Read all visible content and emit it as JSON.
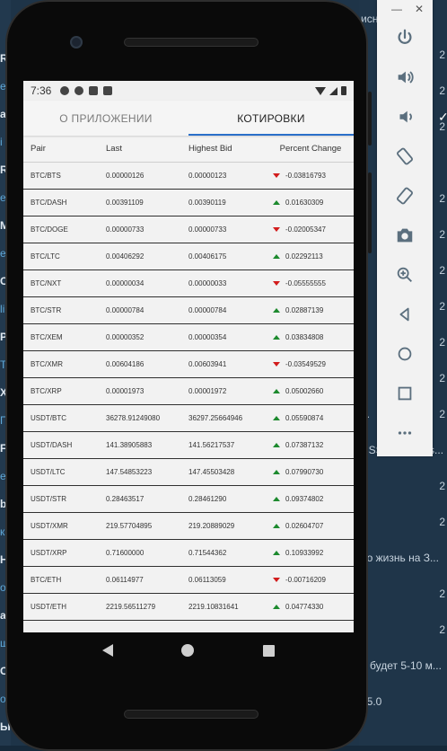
{
  "app": {
    "tabs": [
      {
        "label": "О ПРИЛОЖЕНИИ",
        "active": false
      },
      {
        "label": "КОТИРОВКИ",
        "active": true
      }
    ]
  },
  "statusbar": {
    "time": "7:36"
  },
  "table": {
    "headers": [
      "Pair",
      "Last",
      "Highest Bid",
      "Percent Change"
    ],
    "rows": [
      {
        "pair": "BTC/BTS",
        "last": "0.00000126",
        "bid": "0.00000123",
        "change": "-0.03816793",
        "dir": "down"
      },
      {
        "pair": "BTC/DASH",
        "last": "0.00391109",
        "bid": "0.00390119",
        "change": "0.01630309",
        "dir": "up"
      },
      {
        "pair": "BTC/DOGE",
        "last": "0.00000733",
        "bid": "0.00000733",
        "change": "-0.02005347",
        "dir": "down"
      },
      {
        "pair": "BTC/LTC",
        "last": "0.00406292",
        "bid": "0.00406175",
        "change": "0.02292113",
        "dir": "up"
      },
      {
        "pair": "BTC/NXT",
        "last": "0.00000034",
        "bid": "0.00000033",
        "change": "-0.05555555",
        "dir": "down"
      },
      {
        "pair": "BTC/STR",
        "last": "0.00000784",
        "bid": "0.00000784",
        "change": "0.02887139",
        "dir": "up"
      },
      {
        "pair": "BTC/XEM",
        "last": "0.00000352",
        "bid": "0.00000354",
        "change": "0.03834808",
        "dir": "up"
      },
      {
        "pair": "BTC/XMR",
        "last": "0.00604186",
        "bid": "0.00603941",
        "change": "-0.03549529",
        "dir": "down"
      },
      {
        "pair": "BTC/XRP",
        "last": "0.00001973",
        "bid": "0.00001972",
        "change": "0.05002660",
        "dir": "up"
      },
      {
        "pair": "USDT/BTC",
        "last": "36278.91249080",
        "bid": "36297.25664946",
        "change": "0.05590874",
        "dir": "up"
      },
      {
        "pair": "USDT/DASH",
        "last": "141.38905883",
        "bid": "141.56217537",
        "change": "0.07387132",
        "dir": "up"
      },
      {
        "pair": "USDT/LTC",
        "last": "147.54853223",
        "bid": "147.45503428",
        "change": "0.07990730",
        "dir": "up"
      },
      {
        "pair": "USDT/STR",
        "last": "0.28463517",
        "bid": "0.28461290",
        "change": "0.09374802",
        "dir": "up"
      },
      {
        "pair": "USDT/XMR",
        "last": "219.57704895",
        "bid": "219.20889029",
        "change": "0.02604707",
        "dir": "up"
      },
      {
        "pair": "USDT/XRP",
        "last": "0.71600000",
        "bid": "0.71544362",
        "change": "0.10933992",
        "dir": "up"
      },
      {
        "pair": "BTC/ETH",
        "last": "0.06114977",
        "bid": "0.06113059",
        "change": "-0.00716209",
        "dir": "down"
      },
      {
        "pair": "USDT/ETH",
        "last": "2219.56511279",
        "bid": "2219.10831641",
        "change": "0.04774330",
        "dir": "up"
      }
    ]
  },
  "background": {
    "left_chars": [
      {
        "t": "R",
        "sub": false
      },
      {
        "t": "e",
        "sub": true
      },
      {
        "t": "ar",
        "sub": false
      },
      {
        "t": "i",
        "sub": true
      },
      {
        "t": "R",
        "sub": false
      },
      {
        "t": "e",
        "sub": true
      },
      {
        "t": "M",
        "sub": false
      },
      {
        "t": "e",
        "sub": true
      },
      {
        "t": "C",
        "sub": false
      },
      {
        "t": "li",
        "sub": true
      },
      {
        "t": "P",
        "sub": false
      },
      {
        "t": "T",
        "sub": true
      },
      {
        "t": "X",
        "sub": false
      },
      {
        "t": "П",
        "sub": true
      },
      {
        "t": "F",
        "sub": false
      },
      {
        "t": "e",
        "sub": true
      },
      {
        "t": "bi",
        "sub": false
      },
      {
        "t": "к",
        "sub": true
      },
      {
        "t": "Н",
        "sub": false
      },
      {
        "t": "о",
        "sub": true
      },
      {
        "t": "ar",
        "sub": false
      },
      {
        "t": "ш",
        "sub": true
      },
      {
        "t": "С",
        "sub": false
      },
      {
        "t": "о",
        "sub": true
      },
      {
        "t": "Ы",
        "sub": false
      }
    ],
    "right_lines": [
      {
        "text": "исн",
        "time": ""
      },
      {
        "text": "",
        "time": "2"
      },
      {
        "text": "",
        "time": "2"
      },
      {
        "text": "",
        "time": "2"
      },
      {
        "text": "е",
        "time": ""
      },
      {
        "text": "...",
        "time": "2"
      },
      {
        "text": "",
        "time": "2"
      },
      {
        "text": "",
        "time": "2"
      },
      {
        "text": "",
        "time": "2"
      },
      {
        "text": "",
        "time": "2"
      },
      {
        "text": "",
        "time": "2"
      },
      {
        "text": "...",
        "time": "2"
      },
      {
        "text": "CSS  https://css...",
        "time": ""
      },
      {
        "text": "",
        "time": "2"
      },
      {
        "text": "",
        "time": "2"
      },
      {
        "text": "но жизнь на З...",
        "time": ""
      },
      {
        "text": "",
        "time": "2"
      },
      {
        "text": "",
        "time": "2"
      },
      {
        "text": "е будет 5-10 м...",
        "time": ""
      },
      {
        "text": "25.0",
        "time": ""
      }
    ]
  },
  "toolbar": {
    "minimize": "—",
    "close": "✕",
    "items": [
      {
        "name": "power-icon"
      },
      {
        "name": "volume-up-icon"
      },
      {
        "name": "volume-down-icon"
      },
      {
        "name": "rotate-left-icon"
      },
      {
        "name": "rotate-right-icon"
      },
      {
        "name": "camera-icon"
      },
      {
        "name": "zoom-icon"
      },
      {
        "name": "back-icon"
      },
      {
        "name": "home-icon"
      },
      {
        "name": "overview-icon"
      },
      {
        "name": "more-icon"
      }
    ]
  }
}
